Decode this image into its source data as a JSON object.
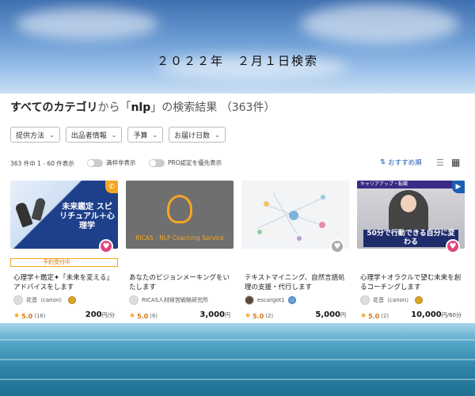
{
  "caption": "２０２２年　２月１日検索",
  "header": {
    "category_link": "すべてのカテゴリ",
    "from_text": "から「",
    "query": "nlp",
    "suffix": "」の検索結果",
    "count": "（363件）"
  },
  "filters": [
    {
      "label": "提供方法"
    },
    {
      "label": "出品者情報"
    },
    {
      "label": "予算"
    },
    {
      "label": "お届け日数"
    }
  ],
  "toolbar": {
    "count_text": "363 件中 1 - 60 件表示",
    "toggle_closed": "満枠非表示",
    "toggle_pro": "PRO認定を優先表示",
    "sort_label": "おすすめ順"
  },
  "cards": [
    {
      "thumb_text": "未来鑑定 スピリチュアル＋心理学",
      "badge": "予約受付中",
      "title": "心理学＋鑑定✦「未来を変える」アドバイスをします",
      "seller": "花音（canon）",
      "rating": "5.0",
      "reviews": "(16)",
      "price": "200",
      "unit": "円/分"
    },
    {
      "thumb_text": "RICAS - NLP Coaching Service",
      "title": "あなたのビジョンメーキングをいたします",
      "seller": "RICAS人材経営戦略研究所",
      "rating": "5.0",
      "reviews": "(6)",
      "price": "3,000",
      "unit": "円"
    },
    {
      "title": "テキストマイニング、自然言語処理の支援・代行します",
      "seller": "escargot1",
      "rating": "5.0",
      "reviews": "(2)",
      "price": "5,000",
      "unit": "円"
    },
    {
      "thumb_top": "キャリアアップ・転職",
      "thumb_text": "50分で行動できる自分に変わる",
      "title": "心理学＋オラクルで望む未来を創るコーチングします",
      "seller": "花音（canon）",
      "rating": "5.0",
      "reviews": "(2)",
      "price": "10,000",
      "unit": "円/60分"
    }
  ],
  "colors": {
    "accent": "#1a5fb4",
    "favorite": "#e0457b",
    "rating": "#f5a623"
  }
}
